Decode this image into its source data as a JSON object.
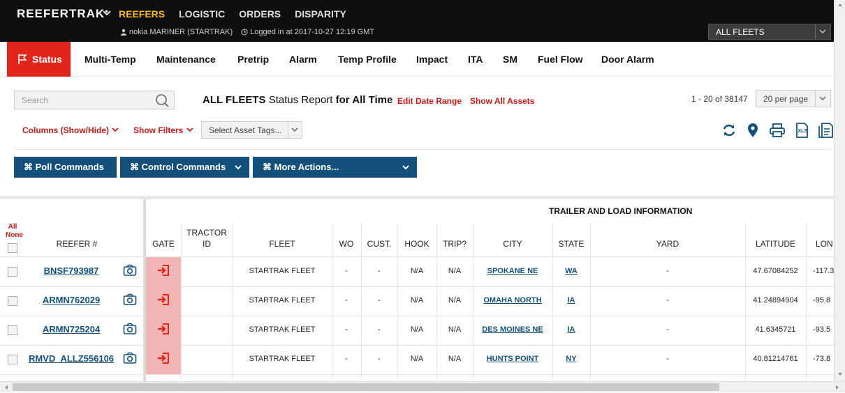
{
  "app": {
    "brand": "REEFERTRAK",
    "nav": [
      "REEFERS",
      "LOGISTIC",
      "ORDERS",
      "DISPARITY"
    ],
    "nav_active": "REEFERS",
    "user": "nokia MARINER (STARTRAK)",
    "login": "Logged in at 2017-10-27 12:19 GMT",
    "fleet_select": "ALL FLEETS"
  },
  "tabs": [
    "Status",
    "Multi-Temp",
    "Maintenance",
    "Pretrip",
    "Alarm",
    "Temp Profile",
    "Impact",
    "ITA",
    "SM",
    "Fuel Flow",
    "Door Alarm"
  ],
  "toolbar": {
    "search_placeholder": "Search",
    "report_fleet": "ALL FLEETS",
    "report_mid": "Status Report",
    "report_range": "for All Time",
    "edit_date": "Edit Date Range",
    "show_assets": "Show All Assets",
    "pager": "1 - 20 of 38147",
    "per_page": "20 per page",
    "columns_toggle": "Columns (Show/Hide)",
    "show_filters": "Show Filters",
    "asset_tags": "Select Asset Tags...",
    "poll": "⌘ Poll Commands",
    "control": "⌘ Control Commands",
    "more": "⌘ More Actions..."
  },
  "table": {
    "group_header": "TRAILER AND LOAD INFORMATION",
    "select_all": "All",
    "select_none": "None",
    "headers": {
      "reefer": "REEFER #",
      "gate": "GATE",
      "tractor1": "TRACTOR",
      "tractor2": "ID",
      "fleet": "FLEET",
      "wo": "WO",
      "cust": "CUST.",
      "hook": "HOOK",
      "trip": "TRIP?",
      "city": "CITY",
      "state": "STATE",
      "yard": "YARD",
      "lat": "LATITUDE",
      "lon": "LON"
    },
    "rows": [
      {
        "reefer": "BNSF793987",
        "fleet": "STARTRAK FLEET",
        "wo": "-",
        "cust": "-",
        "hook": "N/A",
        "trip": "N/A",
        "city": "SPOKANE NE",
        "state": "WA",
        "yard": "-",
        "lat": "47.67084252",
        "lon": "-117.3"
      },
      {
        "reefer": "ARMN762029",
        "fleet": "STARTRAK FLEET",
        "wo": "-",
        "cust": "-",
        "hook": "N/A",
        "trip": "N/A",
        "city": "OMAHA NORTH",
        "state": "IA",
        "yard": "-",
        "lat": "41.24894904",
        "lon": "-95.8"
      },
      {
        "reefer": "ARMN725204",
        "fleet": "STARTRAK FLEET",
        "wo": "-",
        "cust": "-",
        "hook": "N/A",
        "trip": "N/A",
        "city": "DES MOINES NE",
        "state": "IA",
        "yard": "-",
        "lat": "41.6345721",
        "lon": "-93.5"
      },
      {
        "reefer": "RMVD_ALLZ556106",
        "fleet": "STARTRAK FLEET",
        "wo": "-",
        "cust": "-",
        "hook": "N/A",
        "trip": "N/A",
        "city": "HUNTS POINT",
        "state": "NY",
        "yard": "-",
        "lat": "40.81214761",
        "lon": "-73.8"
      }
    ]
  },
  "colors": {
    "accent_red": "#e1251b",
    "nav_gold": "#f2b722",
    "button_blue": "#15507c",
    "link_blue": "#14507e"
  }
}
